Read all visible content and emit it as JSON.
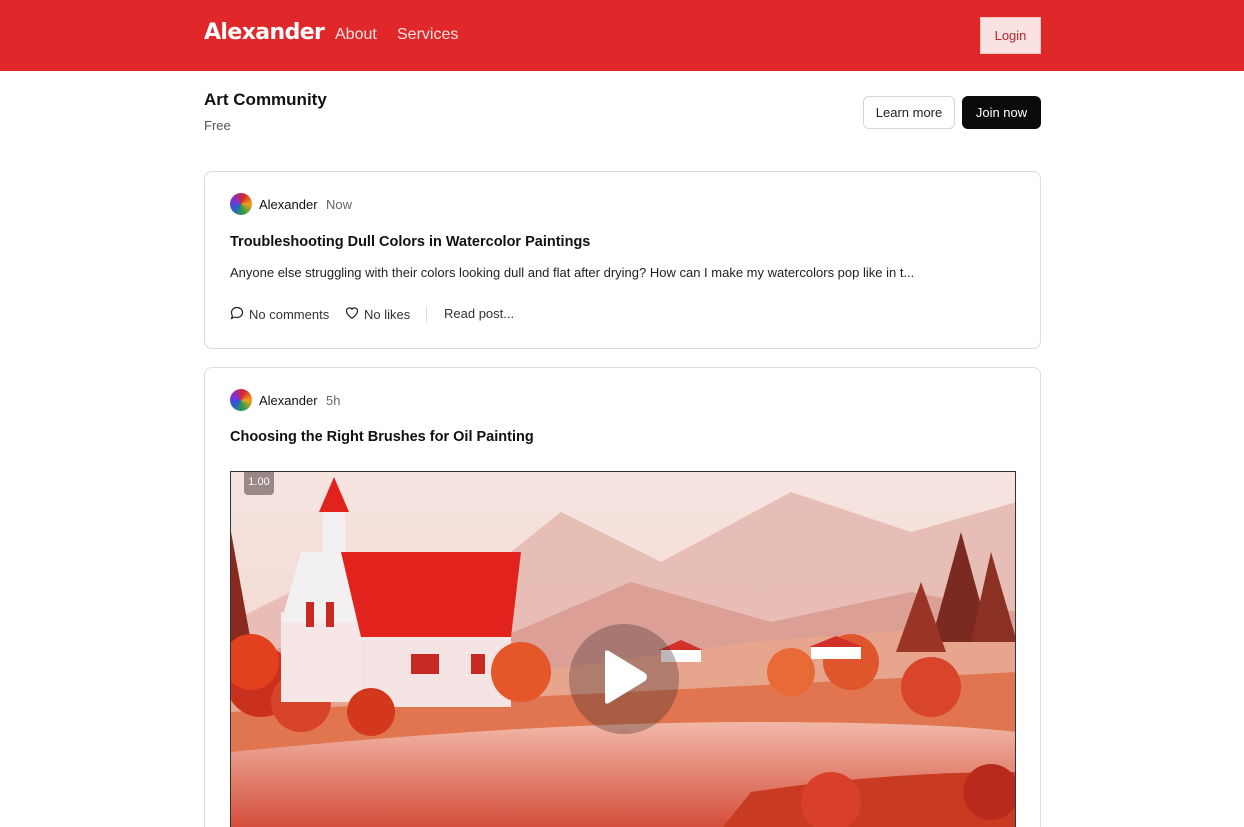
{
  "header": {
    "brand": "Alexander",
    "nav": [
      "About",
      "Services"
    ],
    "login_label": "Login",
    "color": "#e0282a"
  },
  "community": {
    "title": "Art Community",
    "price": "Free",
    "learn_more_label": "Learn more",
    "join_label": "Join now"
  },
  "posts": [
    {
      "author": "Alexander",
      "time": "Now",
      "title": "Troubleshooting Dull Colors in Watercolor Paintings",
      "excerpt": "Anyone else struggling with their colors looking dull and flat after drying? How can I make my watercolors pop like in t...",
      "comments": "No comments",
      "likes": "No likes",
      "read_label": "Read post..."
    },
    {
      "author": "Alexander",
      "time": "5h",
      "title": "Choosing the Right Brushes for Oil Painting",
      "video": {
        "speed": "1.00"
      }
    }
  ],
  "icons": [
    "comment-icon",
    "heart-icon",
    "play-icon",
    "avatar"
  ]
}
